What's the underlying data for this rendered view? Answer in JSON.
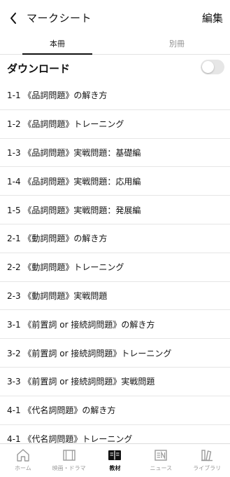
{
  "header": {
    "title": "マークシート",
    "edit_label": "編集"
  },
  "tabs": [
    {
      "label": "本冊",
      "active": true
    },
    {
      "label": "別冊",
      "active": false
    }
  ],
  "download": {
    "label": "ダウンロード",
    "enabled": false
  },
  "list": [
    {
      "label": "1-1 《品詞問題》の解き方"
    },
    {
      "label": "1-2 《品詞問題》トレーニング"
    },
    {
      "label": "1-3 《品詞問題》実戦問題：基礎編"
    },
    {
      "label": "1-4 《品詞問題》実戦問題：応用編"
    },
    {
      "label": "1-5 《品詞問題》実戦問題：発展編"
    },
    {
      "label": "2-1 《動詞問題》の解き方"
    },
    {
      "label": "2-2 《動詞問題》トレーニング"
    },
    {
      "label": "2-3 《動詞問題》実戦問題"
    },
    {
      "label": "3-1 《前置詞 or 接続詞問題》の解き方"
    },
    {
      "label": "3-2 《前置詞 or 接続詞問題》トレーニング"
    },
    {
      "label": "3-3 《前置詞 or 接続詞問題》実戦問題"
    },
    {
      "label": "4-1 《代名詞問題》の解き方"
    },
    {
      "label": "4-1 《代名詞問題》トレーニング"
    }
  ],
  "tabbar": [
    {
      "label": "ホーム",
      "icon": "home-icon",
      "active": false
    },
    {
      "label": "映画・ドラマ",
      "icon": "film-icon",
      "active": false
    },
    {
      "label": "教材",
      "icon": "book-icon",
      "active": true
    },
    {
      "label": "ニュース",
      "icon": "news-icon",
      "active": false
    },
    {
      "label": "ライブラリ",
      "icon": "library-icon",
      "active": false
    }
  ],
  "colors": {
    "text": "#111111",
    "muted": "#8e8e8e",
    "divider": "#e6e6e6",
    "toggle_off": "#e6e6e6"
  }
}
